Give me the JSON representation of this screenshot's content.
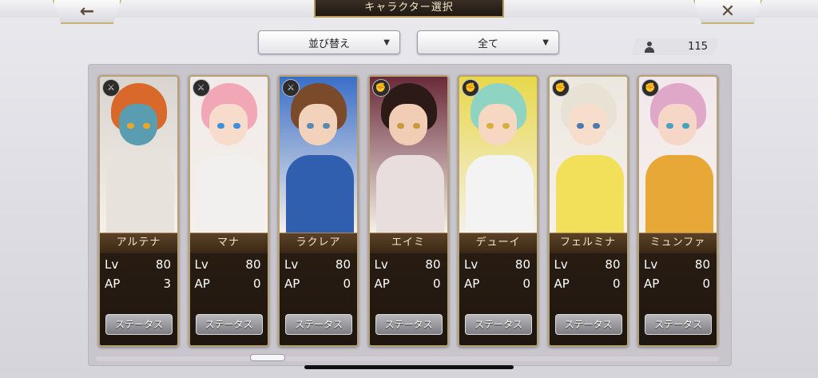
{
  "header": {
    "title": "キャラクター選択",
    "back_icon": "←",
    "close_icon": "✕"
  },
  "toolbar": {
    "sort_label": "並び替え",
    "filter_label": "全て",
    "dropdown_arrow": "▼"
  },
  "roster": {
    "count": "115"
  },
  "labels": {
    "lv": "Lv",
    "ap": "AP",
    "status": "ステータス"
  },
  "cards": [
    {
      "name": "アルテナ",
      "lv": "80",
      "ap": "3",
      "emblem": "weapon-emblem-icon",
      "hair": "#d8692a",
      "skin": "#5b9db0",
      "outfit": "#e8e2dc",
      "eyes": "#e8a82a",
      "bg": "#d9d4cf"
    },
    {
      "name": "マナ",
      "lv": "80",
      "ap": "0",
      "emblem": "weapon-emblem-icon",
      "hair": "#f2a7b6",
      "skin": "#f7dccc",
      "outfit": "#f2f0ee",
      "eyes": "#3e8fe0",
      "bg": "#f1eaea"
    },
    {
      "name": "ラクレア",
      "lv": "80",
      "ap": "0",
      "emblem": "weapon-emblem-icon",
      "hair": "#7a4a2a",
      "skin": "#f2d2bb",
      "outfit": "#2f5fae",
      "eyes": "#5a8ab0",
      "bg": "#3a6fc8"
    },
    {
      "name": "エイミ",
      "lv": "80",
      "ap": "0",
      "emblem": "fist-emblem-icon",
      "hair": "#2b1a16",
      "skin": "#f1cdb6",
      "outfit": "#e8dede",
      "eyes": "#c89a3a",
      "bg": "#6a2a3a"
    },
    {
      "name": "デューイ",
      "lv": "80",
      "ap": "0",
      "emblem": "fist-emblem-icon",
      "hair": "#8fd4c2",
      "skin": "#f6d8c2",
      "outfit": "#f3f3f3",
      "eyes": "#d4b03a",
      "bg": "#e8d84a"
    },
    {
      "name": "フェルミナ",
      "lv": "80",
      "ap": "0",
      "emblem": "fist-emblem-icon",
      "hair": "#e8e2d4",
      "skin": "#f7ddcc",
      "outfit": "#f2df5a",
      "eyes": "#4a7ab0",
      "bg": "#ece8e0"
    },
    {
      "name": "ミュンファ",
      "lv": "80",
      "ap": "0",
      "emblem": "fist-emblem-icon",
      "hair": "#e0a8c8",
      "skin": "#f6d6c6",
      "outfit": "#e8a838",
      "eyes": "#4aa0c0",
      "bg": "#f2e8ec"
    }
  ]
}
